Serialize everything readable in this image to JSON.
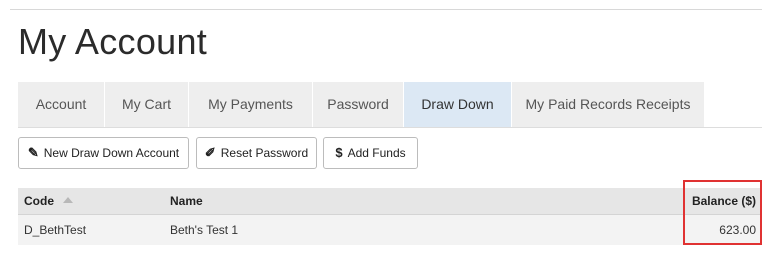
{
  "page": {
    "title": "My Account"
  },
  "tabs": [
    {
      "label": "Account",
      "active": false
    },
    {
      "label": "My Cart",
      "active": false
    },
    {
      "label": "My Payments",
      "active": false
    },
    {
      "label": "Password",
      "active": false
    },
    {
      "label": "Draw Down",
      "active": true
    },
    {
      "label": "My Paid Records Receipts",
      "active": false
    }
  ],
  "toolbar": {
    "new_account": {
      "label": "New Draw Down Account",
      "icon": "pencil-icon"
    },
    "reset_password": {
      "label": "Reset Password",
      "icon": "edit-icon"
    },
    "add_funds": {
      "label": "Add Funds",
      "icon": "dollar-icon",
      "glyph": "$"
    }
  },
  "table": {
    "columns": {
      "code": "Code",
      "name": "Name",
      "balance": "Balance ($)"
    },
    "sort": {
      "column": "code",
      "direction": "ascending"
    },
    "rows": [
      {
        "code": "D_BethTest",
        "name": "Beth's Test 1",
        "balance": "623.00"
      }
    ]
  },
  "colors": {
    "active_tab": "#dce8f4",
    "inactive_tab": "#eeeeee",
    "highlight_border": "#e03232",
    "header_bg": "#e6e6e6",
    "row_bg": "#f3f3f3"
  }
}
